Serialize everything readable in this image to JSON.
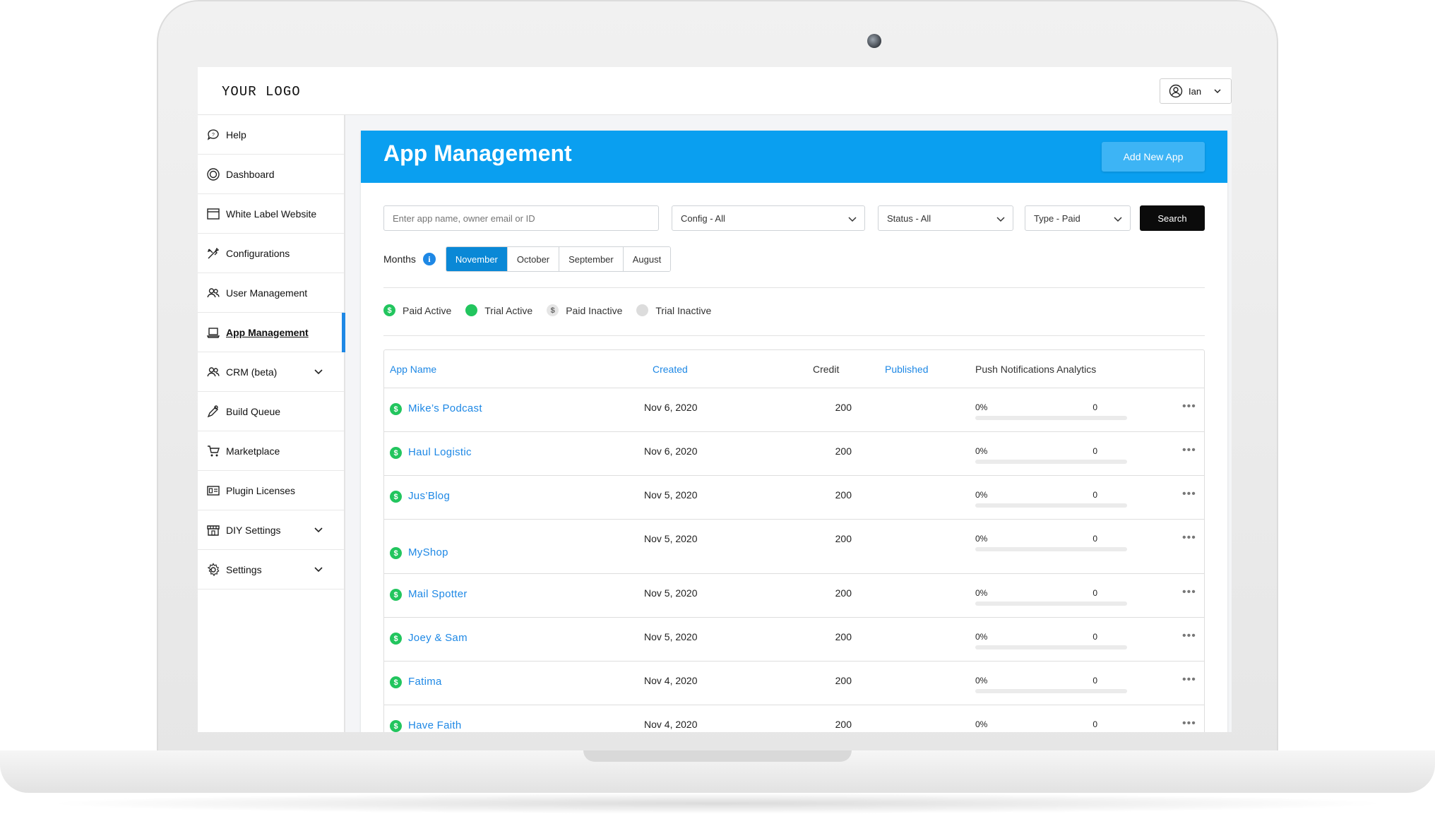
{
  "header": {
    "logo": "YOUR LOGO",
    "user_name": "Ian"
  },
  "sidebar": {
    "items": [
      {
        "label": "Help",
        "icon": "chat-bubble-icon"
      },
      {
        "label": "Dashboard",
        "icon": "dashboard-icon"
      },
      {
        "label": "White Label Website",
        "icon": "browser-window-icon"
      },
      {
        "label": "Configurations",
        "icon": "tools-icon"
      },
      {
        "label": "User Management",
        "icon": "users-icon"
      },
      {
        "label": "App Management",
        "icon": "laptop-icon",
        "active": true
      },
      {
        "label": "CRM (beta)",
        "icon": "users-icon",
        "has_caret": true
      },
      {
        "label": "Build Queue",
        "icon": "pen-tool-icon"
      },
      {
        "label": "Marketplace",
        "icon": "cart-icon"
      },
      {
        "label": "Plugin Licenses",
        "icon": "license-icon"
      },
      {
        "label": "DIY Settings",
        "icon": "storefront-icon",
        "has_caret": true
      },
      {
        "label": "Settings",
        "icon": "gear-icon",
        "has_caret": true
      }
    ]
  },
  "panel": {
    "title": "App Management",
    "add_button": "Add New App"
  },
  "filters": {
    "search_placeholder": "Enter app name, owner email or ID",
    "config": "Config - All",
    "status": "Status - All",
    "type": "Type - Paid",
    "search_button": "Search"
  },
  "months": {
    "label": "Months",
    "options": [
      "November",
      "October",
      "September",
      "August"
    ],
    "selected": "November"
  },
  "legend": [
    {
      "label": "Paid Active",
      "color": "#22c55e",
      "glyph": "$"
    },
    {
      "label": "Trial Active",
      "color": "#22c55e",
      "glyph": ""
    },
    {
      "label": "Paid Inactive",
      "color": "#e5e5e5",
      "glyph": "$"
    },
    {
      "label": "Trial Inactive",
      "color": "#dcdcdc",
      "glyph": ""
    }
  ],
  "table": {
    "columns": {
      "app_name": "App Name",
      "created": "Created",
      "credit": "Credit",
      "published": "Published",
      "push": "Push Notifications Analytics"
    },
    "rows": [
      {
        "name": "Mike’s Podcast",
        "created": "Nov 6, 2020",
        "credit": "200",
        "pct": "0%",
        "count": "0",
        "progress": 0
      },
      {
        "name": "Haul Logistic",
        "created": "Nov 6, 2020",
        "credit": "200",
        "pct": "0%",
        "count": "0",
        "progress": 0
      },
      {
        "name": "Jus’Blog",
        "created": "Nov 5, 2020",
        "credit": "200",
        "pct": "0%",
        "count": "0",
        "progress": 0
      },
      {
        "name": "MyShop",
        "created": "Nov 5, 2020",
        "credit": "200",
        "pct": "0%",
        "count": "0",
        "progress": 0
      },
      {
        "name": "Mail Spotter",
        "created": "Nov 5, 2020",
        "credit": "200",
        "pct": "0%",
        "count": "0",
        "progress": 0
      },
      {
        "name": "Joey & Sam",
        "created": "Nov 5, 2020",
        "credit": "200",
        "pct": "0%",
        "count": "0",
        "progress": 0
      },
      {
        "name": "Fatima",
        "created": "Nov 4, 2020",
        "credit": "200",
        "pct": "0%",
        "count": "0",
        "progress": 0
      },
      {
        "name": "Have Faith",
        "created": "Nov 4, 2020",
        "credit": "200",
        "pct": "0%",
        "count": "0",
        "progress": 0
      }
    ],
    "more_glyph": "•••",
    "paid_glyph": "$"
  },
  "colors": {
    "accent": "#0a9ff0",
    "link": "#1e88e5",
    "active_green": "#22c55e"
  }
}
